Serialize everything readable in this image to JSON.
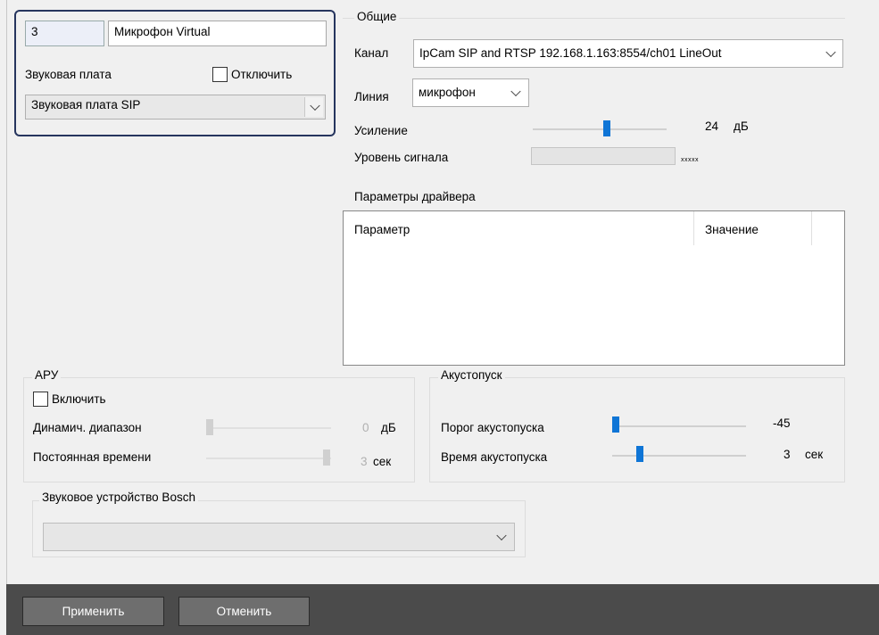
{
  "header": {
    "id_value": "3",
    "name_value": "Микрофон Virtual",
    "sound_card_label": "Звуковая плата",
    "disable_label": "Отключить",
    "sound_card_value": "Звуковая плата SIP"
  },
  "general": {
    "title": "Общие",
    "channel_label": "Канал",
    "channel_value": "IpCam SIP and RTSP 192.168.1.163:8554/ch01 LineOut",
    "line_label": "Линия",
    "line_value": "микрофон",
    "gain_label": "Усиление",
    "gain_value": "24",
    "gain_unit": "дБ",
    "gain_level": 0.55,
    "signal_label": "Уровень сигнала",
    "signal_text": "xxxxx"
  },
  "driver": {
    "title": "Параметры драйвера",
    "columns": [
      "Параметр",
      "Значение"
    ]
  },
  "agc": {
    "title": "АРУ",
    "enable_label": "Включить",
    "range_label": "Динамич. диапазон",
    "range_value": "0",
    "range_unit": "дБ",
    "time_label": "Постоянная времени",
    "time_value": "3",
    "time_unit": "сек"
  },
  "vox": {
    "title": "Акустопуск",
    "threshold_label": "Порог акустопуска",
    "threshold_value": "-45",
    "time_label": "Время акустопуска",
    "time_value": "3",
    "time_unit": "сек"
  },
  "bosch": {
    "title": "Звуковое устройство Bosch",
    "value": ""
  },
  "footer": {
    "apply_label": "Применить",
    "cancel_label": "Отменить"
  },
  "colors": {
    "accent": "#0f75d6",
    "card_border": "#26355e",
    "footer_bg": "#4b4b4b"
  }
}
